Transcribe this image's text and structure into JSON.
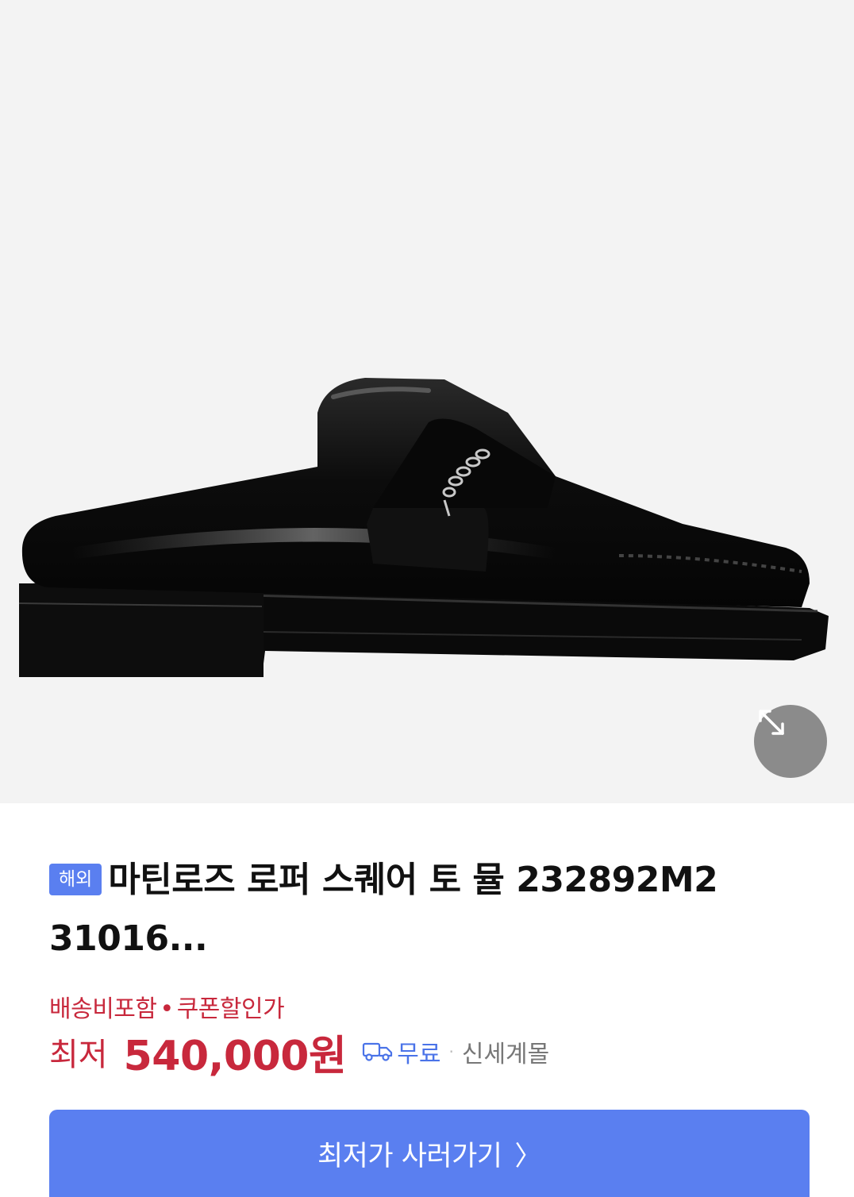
{
  "product": {
    "badge": "해외",
    "title_line1": "마틴로즈 로퍼 스퀘어 토 뮬 232892M2",
    "title_line2": "31016...",
    "image_alt": "black patent leather square toe loafer mule with silver chain"
  },
  "shipping_info": {
    "delivery_included": "배송비포함",
    "dot": "•",
    "coupon_price": "쿠폰할인가"
  },
  "price": {
    "label": "최저",
    "value": "540,000원"
  },
  "delivery": {
    "free_label": "무료",
    "separator": "·",
    "mall": "신세계몰"
  },
  "cta": {
    "label": "최저가 사러가기",
    "chevron": "〉"
  },
  "colors": {
    "accent_blue": "#5a7ff0",
    "price_red": "#c8283c"
  }
}
